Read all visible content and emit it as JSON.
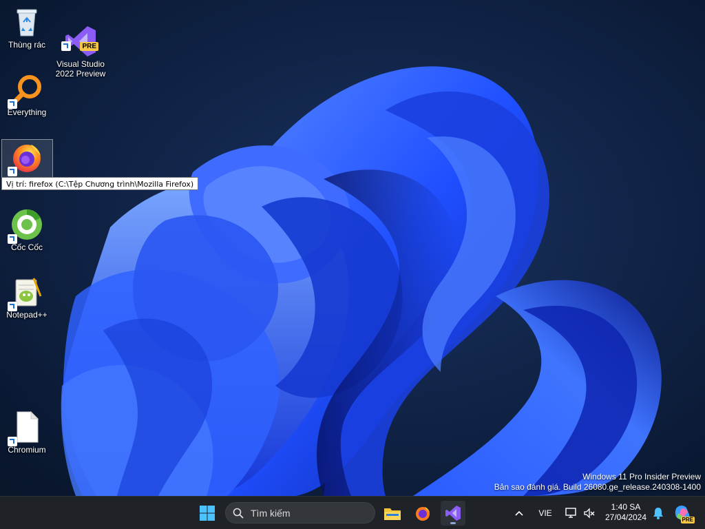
{
  "desktop": {
    "icons": [
      {
        "label": "Thùng rác",
        "icon": "recycle-bin-icon"
      },
      {
        "label": "Visual Studio\n2022 Preview",
        "icon": "visual-studio-icon",
        "badge": "PRE"
      },
      {
        "label": "Everything",
        "icon": "everything-search-icon"
      },
      {
        "label": "Firefox",
        "icon": "firefox-icon"
      },
      {
        "label": "Cốc Cốc",
        "icon": "coccoc-icon"
      },
      {
        "label": "Notepad++",
        "icon": "notepad-plus-plus-icon"
      },
      {
        "label": "Chromium",
        "icon": "blank-file-icon"
      }
    ],
    "tooltip": "Vị trí: firefox (C:\\Tệp Chương trình\\Mozilla Firefox)",
    "watermark": {
      "line1": "Windows 11 Pro Insider Preview",
      "line2": "Bản sao đánh giá. Build 26080.ge_release.240308-1400"
    }
  },
  "taskbar": {
    "search_label": "Tìm kiếm",
    "apps": [
      "start-icon",
      "file-explorer-icon",
      "firefox-icon",
      "visual-studio-icon"
    ],
    "tray": {
      "language": "VIE",
      "time": "1:40 SA",
      "date": "27/04/2024",
      "copilot_badge": "PRE"
    }
  },
  "colors": {
    "background": "#0b1a33",
    "bloom": "#1f4fff",
    "taskbar": "#1f2328"
  }
}
